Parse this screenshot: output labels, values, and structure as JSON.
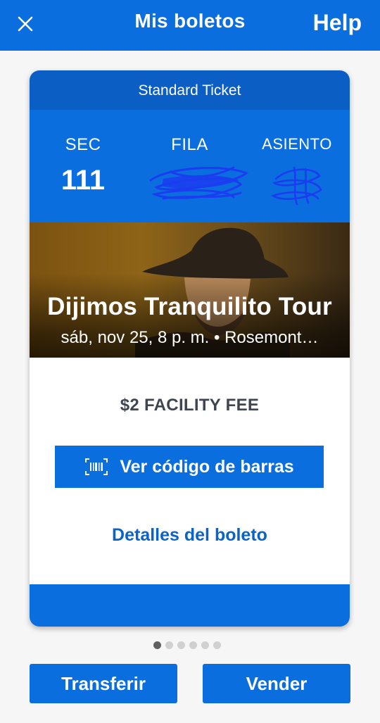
{
  "header": {
    "title": "Mis boletos",
    "help_label": "Help",
    "close_icon": "close-icon"
  },
  "ticket": {
    "type_label": "Standard Ticket",
    "section_label": "SEC",
    "section_value": "111",
    "row_label": "FILA",
    "seat_label": "ASIENTO",
    "event_title": "Dijimos Tranquilito Tour",
    "event_subtitle": "sáb, nov 25, 8 p. m. • Rosemont…",
    "fee_text": "$2 FACILITY FEE",
    "barcode_button_label": "Ver código de barras",
    "barcode_icon": "barcode-icon",
    "details_link_label": "Detalles del boleto"
  },
  "pagination": {
    "total": 6,
    "active_index": 0
  },
  "actions": {
    "transfer_label": "Transferir",
    "sell_label": "Vender"
  },
  "colors": {
    "brand_blue": "#0a6ede",
    "header_dark_blue": "#0b5fc4",
    "link_blue": "#0b63c8",
    "scribble_blue": "#1b3cf0"
  }
}
